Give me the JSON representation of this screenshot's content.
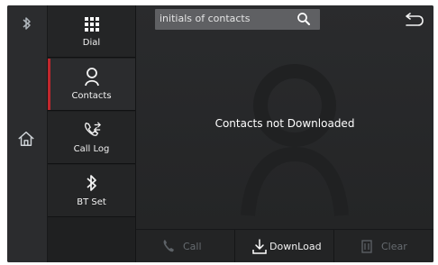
{
  "search": {
    "placeholder": "initials of contacts"
  },
  "nav": {
    "items": [
      {
        "label": "Dial",
        "icon": "dialpad-icon",
        "active": false
      },
      {
        "label": "Contacts",
        "icon": "contact-icon",
        "active": true
      },
      {
        "label": "Call Log",
        "icon": "call-log-icon",
        "active": false
      },
      {
        "label": "BT Set",
        "icon": "bluetooth-icon",
        "active": false
      }
    ]
  },
  "main": {
    "message": "Contacts not Downloaded"
  },
  "actions": [
    {
      "label": "Call",
      "icon": "phone-icon",
      "enabled": false
    },
    {
      "label": "DownLoad",
      "icon": "download-icon",
      "enabled": true
    },
    {
      "label": "Clear",
      "icon": "trash-icon",
      "enabled": false
    }
  ],
  "colors": {
    "active_indicator": "#c1272d",
    "background": "#242526",
    "disabled_text": "#666b70"
  }
}
